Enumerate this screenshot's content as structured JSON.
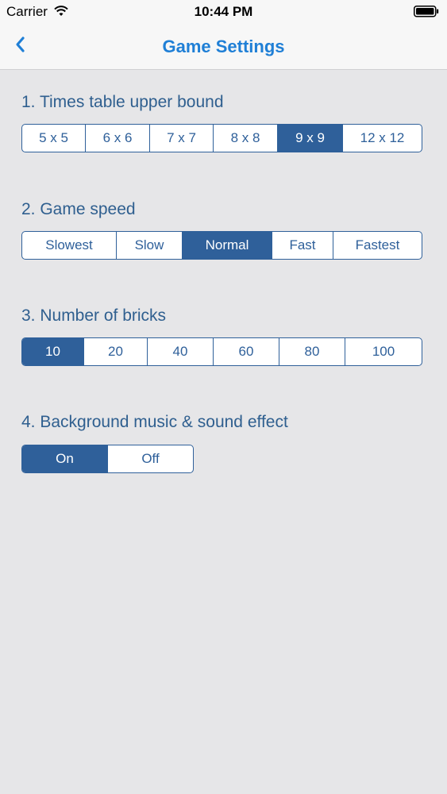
{
  "status_bar": {
    "carrier": "Carrier",
    "time": "10:44 PM"
  },
  "nav": {
    "title": "Game Settings",
    "back_icon": "chevron-left-icon"
  },
  "colors": {
    "accent": "#2f609a",
    "nav_title": "#1f7fd6",
    "background": "#e6e6e8"
  },
  "sections": {
    "times_table": {
      "title": "1. Times table upper bound",
      "options": [
        "5 x 5",
        "6 x 6",
        "7 x 7",
        "8 x 8",
        "9 x 9",
        "12 x 12"
      ],
      "selected": "9 x 9"
    },
    "game_speed": {
      "title": "2. Game speed",
      "options": [
        "Slowest",
        "Slow",
        "Normal",
        "Fast",
        "Fastest"
      ],
      "selected": "Normal"
    },
    "bricks": {
      "title": "3. Number of bricks",
      "options": [
        "10",
        "20",
        "40",
        "60",
        "80",
        "100"
      ],
      "selected": "10"
    },
    "sound": {
      "title": "4. Background music & sound effect",
      "options": [
        "On",
        "Off"
      ],
      "selected": "On"
    }
  }
}
